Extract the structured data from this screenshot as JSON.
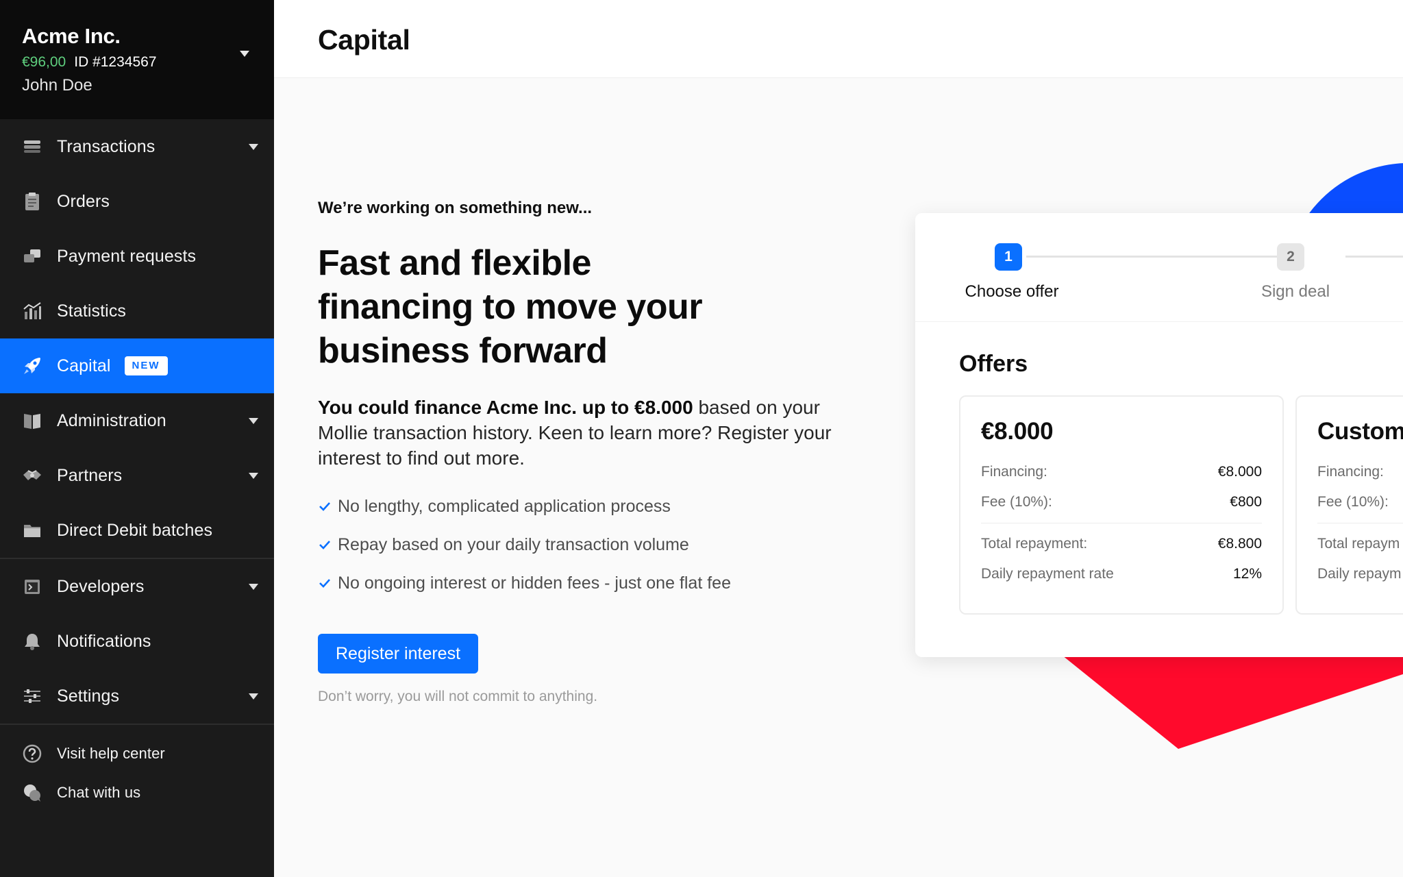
{
  "account": {
    "company": "Acme Inc.",
    "balance": "€96,00",
    "id": "ID #1234567",
    "user": "John Doe"
  },
  "nav": {
    "transactions": "Transactions",
    "orders": "Orders",
    "payment_requests": "Payment requests",
    "statistics": "Statistics",
    "capital": "Capital",
    "capital_badge": "NEW",
    "administration": "Administration",
    "partners": "Partners",
    "direct_debit": "Direct Debit batches",
    "developers": "Developers",
    "notifications": "Notifications",
    "settings": "Settings",
    "help": "Visit help center",
    "chat": "Chat with us"
  },
  "page": {
    "title": "Capital"
  },
  "promo": {
    "eyebrow": "We’re working on something new...",
    "headline": "Fast and flexible financing to move your business forward",
    "lead_bold": "You could finance Acme Inc. up to €8.000",
    "lead_rest": " based on your Mollie transaction history. Keen to learn more? Register your interest to find out more.",
    "benefits": [
      "No lengthy, complicated application process",
      "Repay based on your daily transaction volume",
      "No ongoing interest or hidden fees - just one flat fee"
    ],
    "button": "Register interest",
    "fineprint": "Don’t worry, you will not commit to anything."
  },
  "stepper": {
    "steps": [
      {
        "number": "1",
        "label": "Choose offer"
      },
      {
        "number": "2",
        "label": "Sign deal"
      }
    ]
  },
  "offers": {
    "title": "Offers",
    "cards": [
      {
        "amount": "€8.000",
        "financing_label": "Financing:",
        "financing_value": "€8.000",
        "fee_label": "Fee (10%):",
        "fee_value": "€800",
        "total_label": "Total repayment:",
        "total_value": "€8.800",
        "rate_label": "Daily repayment rate",
        "rate_value": "12%"
      },
      {
        "amount": "Custom",
        "financing_label": "Financing:",
        "fee_label": "Fee (10%):",
        "total_label": "Total repaym",
        "rate_label": "Daily repaym"
      }
    ]
  },
  "colors": {
    "accent": "#0a70ff",
    "sidebar": "#1b1b1b",
    "balance": "#5fcf7e",
    "deco_blue": "#0a4dff",
    "deco_red": "#ff0a2c"
  }
}
